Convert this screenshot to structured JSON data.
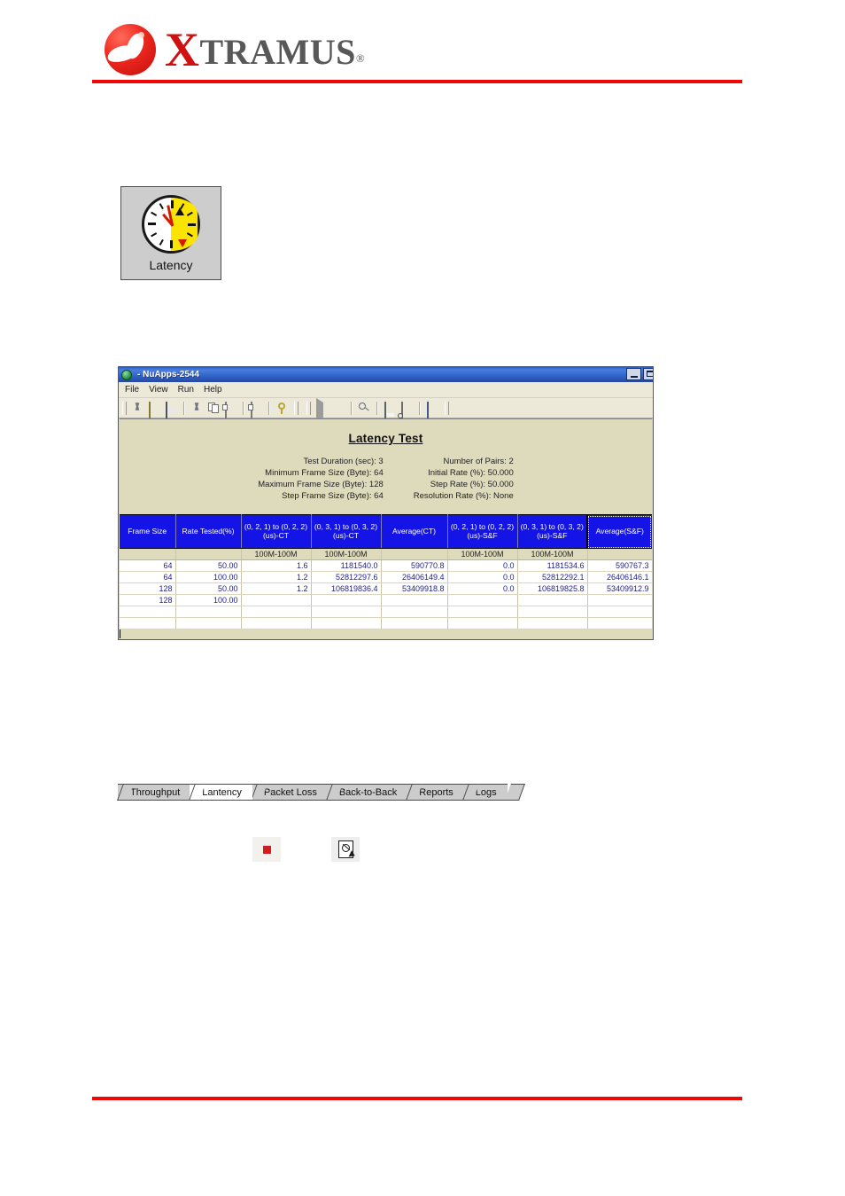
{
  "brand": {
    "logo_x": "X",
    "logo_rest": "TRAMUS",
    "logo_registered": "®",
    "logo_mark_name": "xtramus-sphere-logo"
  },
  "latency_icon_button": {
    "label": "Latency",
    "icon": "clock-icon"
  },
  "app_window": {
    "title": "- NuApps-2544",
    "app_icon": "nuapps-globe-icon",
    "window_controls": [
      {
        "name": "minimize-button",
        "glyph": "minimize"
      },
      {
        "name": "maximize-button",
        "glyph": "maximize"
      }
    ],
    "menu": [
      {
        "label": "File",
        "accel": "F"
      },
      {
        "label": "View",
        "accel": "V"
      },
      {
        "label": "Run",
        "accel": "R"
      },
      {
        "label": "Help",
        "accel": "H"
      }
    ],
    "toolbar": {
      "group_one": [
        {
          "name": "new-button",
          "icon": "new-document-icon"
        },
        {
          "name": "open-button",
          "icon": "open-folder-icon"
        },
        {
          "name": "save-button",
          "icon": "floppy-disk-icon"
        }
      ],
      "group_two": [
        {
          "name": "cut-button",
          "icon": "scissors-icon"
        },
        {
          "name": "copy-button",
          "icon": "copy-pages-icon"
        },
        {
          "name": "paste-button",
          "icon": "clipboard-icon"
        }
      ],
      "group_three": [
        {
          "name": "properties-button",
          "icon": "properties-icon"
        }
      ],
      "group_four": [
        {
          "name": "help-button",
          "icon": "key-icon"
        }
      ],
      "group_five": [
        {
          "name": "run-button",
          "icon": "play-icon"
        },
        {
          "name": "stop-button",
          "icon": "stop-square-icon"
        }
      ],
      "group_six": [
        {
          "name": "zoom-button",
          "icon": "magnifier-icon"
        },
        {
          "name": "print-button",
          "icon": "printer-icon"
        },
        {
          "name": "print-preview-button",
          "icon": "print-preview-icon"
        },
        {
          "name": "grid-view-button",
          "icon": "grid-icon"
        }
      ]
    },
    "report": {
      "title": "Latency Test",
      "params_left": [
        "Test Duration (sec): 3",
        "Minimum Frame Size (Byte): 64",
        "Maximum Frame Size (Byte): 128",
        "Step Frame Size (Byte): 64"
      ],
      "params_right": [
        "Number of Pairs: 2",
        "Initial Rate (%): 50.000",
        "Step Rate (%): 50.000",
        "Resolution Rate (%): None"
      ]
    },
    "grid": {
      "headers": [
        "Frame Size",
        "Rate Tested(%)",
        "(0, 2, 1) to (0, 2, 2) (us)-CT",
        "(0, 3, 1) to (0, 3, 2) (us)-CT",
        "Average(CT)",
        "(0, 2, 1) to (0, 2, 2) (us)-S&F",
        "(0, 3, 1) to (0, 3, 2) (us)-S&F",
        "Average(S&F)"
      ],
      "selected_header_index": 7,
      "subheaders": [
        "",
        "",
        "100M-100M",
        "100M-100M",
        "",
        "100M-100M",
        "100M-100M",
        ""
      ],
      "rows": [
        [
          "64",
          "50.00",
          "1.6",
          "1181540.0",
          "590770.8",
          "0.0",
          "1181534.6",
          "590767.3"
        ],
        [
          "64",
          "100.00",
          "1.2",
          "52812297.6",
          "26406149.4",
          "0.0",
          "52812292.1",
          "26406146.1"
        ],
        [
          "128",
          "50.00",
          "1.2",
          "106819836.4",
          "53409918.8",
          "0.0",
          "106819825.8",
          "53409912.9"
        ],
        [
          "128",
          "100.00",
          "",
          "",
          "",
          "",
          "",
          ""
        ],
        [
          "",
          "",
          "",
          "",
          "",
          "",
          "",
          ""
        ],
        [
          "",
          "",
          "",
          "",
          "",
          "",
          "",
          ""
        ]
      ]
    }
  },
  "tabs": [
    {
      "label": "Throughput",
      "active": false
    },
    {
      "label": "Lantency",
      "active": true
    },
    {
      "label": "Packet Loss",
      "active": false
    },
    {
      "label": "Back-to-Back",
      "active": false
    },
    {
      "label": "Reports",
      "active": false
    },
    {
      "label": "Logs",
      "active": false
    }
  ],
  "action_buttons": [
    {
      "name": "stop-test-button",
      "icon": "stop-square-icon"
    },
    {
      "name": "report-preview-button",
      "icon": "report-preview-icon"
    }
  ],
  "colors": {
    "brand_red": "#f20505",
    "logo_grey": "#585858",
    "grid_header_blue": "#1414e6",
    "report_bg": "#dedbbd",
    "titlebar_blue": "#3366cc",
    "value_text": "#23238c"
  }
}
